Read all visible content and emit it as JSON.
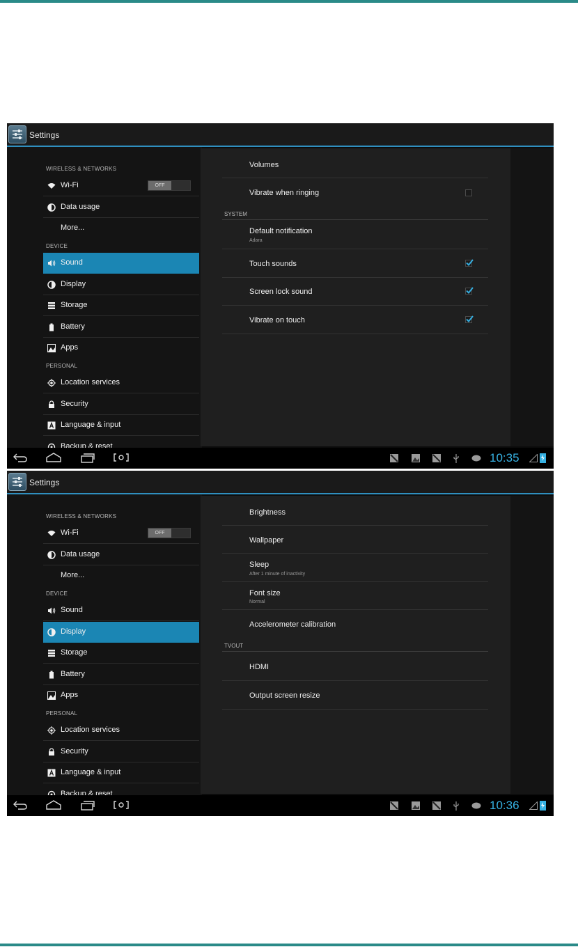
{
  "screens": [
    {
      "app_title": "Settings",
      "categories": {
        "wireless": "WIRELESS & NETWORKS",
        "device": "DEVICE",
        "personal": "PERSONAL"
      },
      "menu": {
        "wifi": "Wi-Fi",
        "wifi_toggle": "OFF",
        "data_usage": "Data usage",
        "more": "More...",
        "sound": "Sound",
        "display": "Display",
        "storage": "Storage",
        "battery": "Battery",
        "apps": "Apps",
        "location": "Location services",
        "security": "Security",
        "language": "Language & input",
        "backup": "Backup & reset"
      },
      "selected": "Sound",
      "content": {
        "volumes": "Volumes",
        "vibrate_ringing": "Vibrate when ringing",
        "system_header": "SYSTEM",
        "default_notification": "Default notification",
        "default_notification_value": "Adara",
        "touch_sounds": "Touch sounds",
        "screen_lock_sound": "Screen lock sound",
        "vibrate_touch": "Vibrate on touch"
      },
      "checkboxes": {
        "vibrate_ringing": false,
        "touch_sounds": true,
        "screen_lock_sound": true,
        "vibrate_touch": true
      },
      "clock": "10:35"
    },
    {
      "app_title": "Settings",
      "categories": {
        "wireless": "WIRELESS & NETWORKS",
        "device": "DEVICE",
        "personal": "PERSONAL"
      },
      "menu": {
        "wifi": "Wi-Fi",
        "wifi_toggle": "OFF",
        "data_usage": "Data usage",
        "more": "More...",
        "sound": "Sound",
        "display": "Display",
        "storage": "Storage",
        "battery": "Battery",
        "apps": "Apps",
        "location": "Location services",
        "security": "Security",
        "language": "Language & input",
        "backup": "Backup & reset"
      },
      "selected": "Display",
      "content": {
        "brightness": "Brightness",
        "wallpaper": "Wallpaper",
        "sleep": "Sleep",
        "sleep_value": "After 1 minute of inactivity",
        "font_size": "Font size",
        "font_size_value": "Normal",
        "accelerometer": "Accelerometer calibration",
        "tvout_header": "TVOUT",
        "hdmi": "HDMI",
        "output_resize": "Output screen resize"
      },
      "clock": "10:36"
    }
  ],
  "colors": {
    "accent": "#1b86b4",
    "clock": "#36b1e3",
    "rule": "#2a8a88",
    "actionbar_line": "#2f8fbf"
  }
}
